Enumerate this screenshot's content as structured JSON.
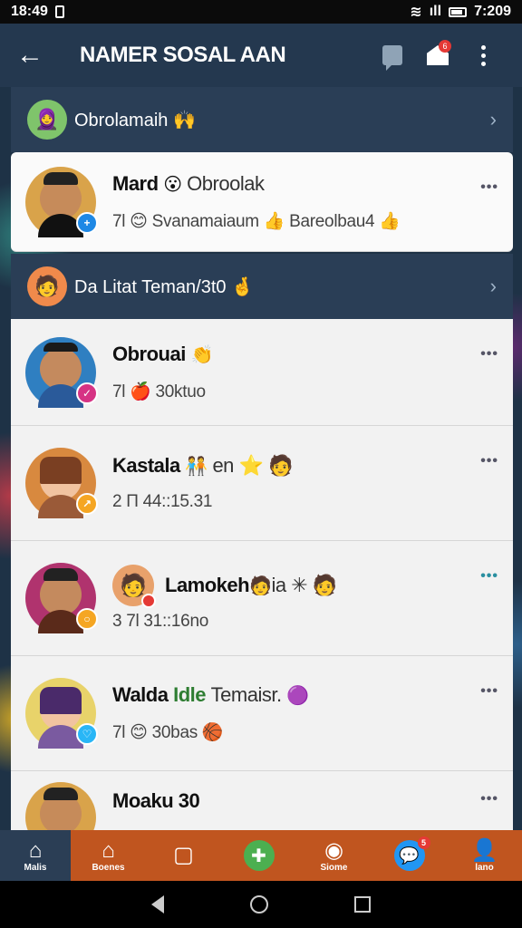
{
  "status_bar": {
    "time": "18:49",
    "left_icon": "sim-icon",
    "right_text": "7:209"
  },
  "app_bar": {
    "back_icon": "arrow-left-icon",
    "title": "NAMER SOSAL AAN",
    "notification_count": "6"
  },
  "groups": [
    {
      "label": "Obrolamaih",
      "emoji": "🙌"
    },
    {
      "label": "Da Litat Teman/3t0",
      "emoji": "🤞"
    }
  ],
  "conversations": [
    {
      "name": "Mard",
      "name_emoji": "😮",
      "name_suffix": "Obroolak",
      "meta": "7l 😊 Svanamaiaum 👍 Bareolbau4 👍",
      "status_color": "#1e88e5",
      "status_glyph": "+"
    },
    {
      "name": "Obrouai",
      "name_emoji": "👏",
      "name_suffix": "",
      "meta": "7l 🍎 30ktuo",
      "status_color": "#d63384",
      "status_glyph": "✓"
    },
    {
      "name": "Kastala",
      "name_emoji": "🧑‍🤝‍🧑",
      "name_suffix": "en ⭐ 🧑",
      "meta": "2 П 44::15.31",
      "status_color": "#f5a623",
      "status_glyph": "↗"
    },
    {
      "name": "Lamokeh",
      "name_emoji": "🧑",
      "name_suffix": "ia ✳ 🧑",
      "meta": "3 7l 31::16no",
      "status_color": "#f5a623",
      "status_glyph": "○"
    },
    {
      "name": "Walda",
      "name_emoji": "",
      "name_green": "Idle",
      "name_suffix": "Temaisr.",
      "meta": "7l 😊 30bas 🏀",
      "status_color": "#29b6f6",
      "status_glyph": "♡"
    },
    {
      "name": "Moaku 30",
      "name_emoji": "",
      "name_suffix": "",
      "meta": ""
    }
  ],
  "bottom_nav": [
    {
      "label": "Malis",
      "icon": "home-icon"
    },
    {
      "label": "Boenes",
      "icon": "home-outline-icon"
    },
    {
      "label": "",
      "icon": "edit-square-icon"
    },
    {
      "label": "",
      "icon": "add-circle-icon"
    },
    {
      "label": "Siome",
      "icon": "camera-icon"
    },
    {
      "label": "",
      "icon": "chat-bubble-icon",
      "badge": "5"
    },
    {
      "label": "lano",
      "icon": "profile-add-icon"
    }
  ],
  "colors": {
    "appbar_bg": "#24384f",
    "nav_bg": "#c0551f",
    "card_bg": "#f2f2f2",
    "accent_teal": "#2a8fa0"
  }
}
